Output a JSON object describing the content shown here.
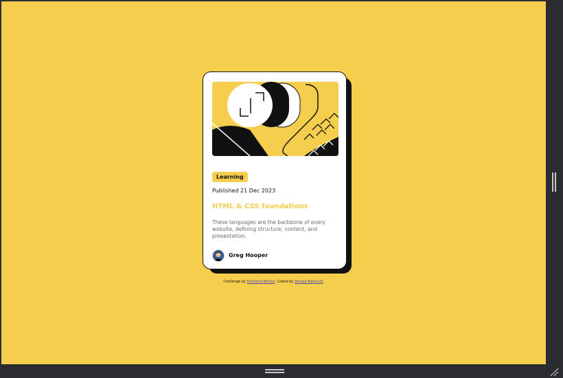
{
  "card": {
    "tag": "Learning",
    "published": "Published 21 Dec 2023",
    "title": "HTML & CSS foundations",
    "description": "These languages are the backbone of every website, defining structure, content, and presentation.",
    "author": "Greg Hooper"
  },
  "attribution": {
    "prefix": "Challenge by ",
    "link1": "Frontend Mentor",
    "middle": ". Coded by ",
    "link2": "Ahmad Mahmud",
    "suffix": "."
  },
  "colors": {
    "background": "#f4ce4c",
    "accent": "#f4ce4c",
    "card": "#ffffff",
    "text": "#111111",
    "muted": "#6b6b6b",
    "frame": "#2b2c30"
  }
}
